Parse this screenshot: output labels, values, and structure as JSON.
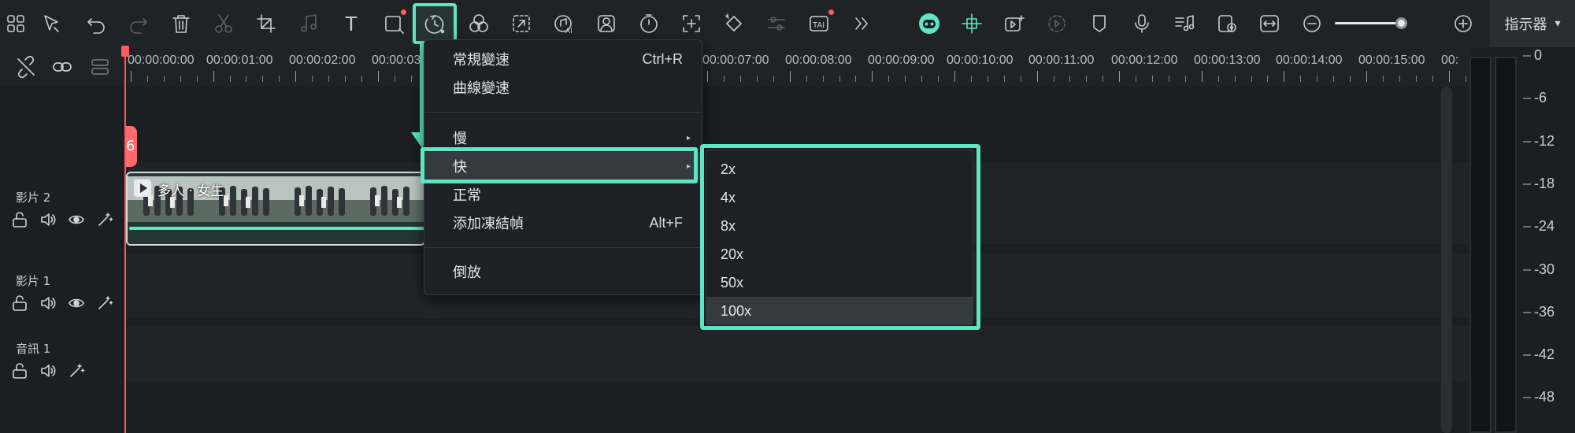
{
  "colors": {
    "accent": "#5ee6c4",
    "playhead": "#ff5b5b",
    "background": "#1b1e22"
  },
  "toolbar": {
    "icons": [
      "grid-icon",
      "select-arrow-icon",
      "undo-icon",
      "redo-icon",
      "delete-icon",
      "cut-icon",
      "crop-icon",
      "audio-icon",
      "text-icon",
      "crop-zoom-icon",
      "speed-icon",
      "color-icon",
      "mask-icon",
      "ai-audio-icon",
      "ai-portrait-icon",
      "timer-icon",
      "freeze-icon",
      "keyframe-icon",
      "adjust-icon",
      "ai-text-icon",
      "more-icon",
      "ai-mascot-icon",
      "scene-detect-icon",
      "video-add-icon",
      "render-icon",
      "marker-icon",
      "mic-icon",
      "music-icon",
      "preview-icon",
      "fit-icon",
      "zoom-out-icon",
      "zoom-in-icon"
    ],
    "text_tool_label": "T",
    "zoom_level": 0.9
  },
  "indicator_tab": {
    "label": "指示器",
    "chevron": "▾"
  },
  "ruler": {
    "timecodes": [
      "00:00:00:00",
      "00:00:01:00",
      "00:00:02:00",
      "00:00:03",
      "00:00:07:00",
      "00:00:08:00",
      "00:00:09:00",
      "00:00:10:00",
      "00:00:11:00",
      "00:00:12:00",
      "00:00:13:00",
      "00:00:14:00",
      "00:00:15:00",
      "00:"
    ]
  },
  "tracks": [
    {
      "name": "影片 2"
    },
    {
      "name": "影片 1"
    },
    {
      "name": "音訊 1"
    }
  ],
  "clip": {
    "title": "多人 · 女生",
    "marker_label": "6"
  },
  "meter": {
    "db_labels": [
      "0",
      "-6",
      "-12",
      "-18",
      "-24",
      "-30",
      "-36",
      "-42",
      "-48"
    ]
  },
  "speed_menu": {
    "items": [
      {
        "label": "常規變速",
        "shortcut": "Ctrl+R"
      },
      {
        "label": "曲線變速",
        "shortcut": ""
      },
      {
        "label": "慢",
        "shortcut": "▸"
      },
      {
        "label": "快",
        "shortcut": "▸"
      },
      {
        "label": "正常",
        "shortcut": ""
      },
      {
        "label": "添加凍結幀",
        "shortcut": "Alt+F"
      },
      {
        "label": "倒放",
        "shortcut": ""
      }
    ]
  },
  "fast_submenu": {
    "items": [
      "2x",
      "4x",
      "8x",
      "20x",
      "50x",
      "100x"
    ],
    "selected": "100x"
  }
}
